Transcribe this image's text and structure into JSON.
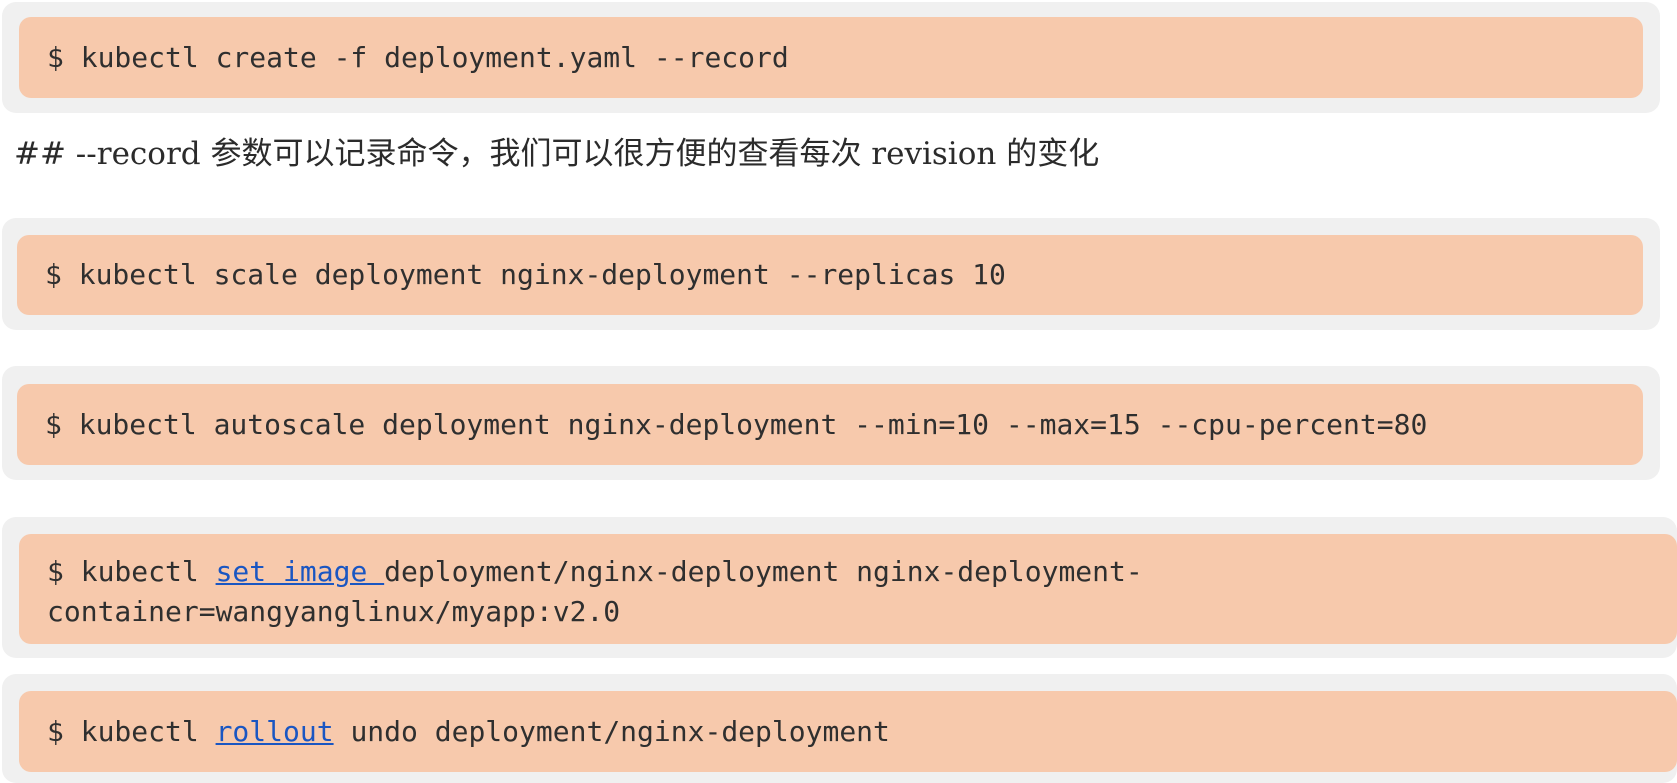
{
  "blocks": {
    "create": {
      "text": "$ kubectl create -f deployment.yaml --record"
    },
    "comment": "## --record 参数可以记录命令，我们可以很方便的查看每次 revision 的变化",
    "scale": {
      "text": "$ kubectl scale deployment nginx-deployment --replicas 10"
    },
    "autoscale": {
      "text": "$ kubectl autoscale deployment nginx-deployment --min=10 --max=15 --cpu-percent=80"
    },
    "set_image": {
      "prefix": "$ kubectl ",
      "link": "set image ",
      "suffix_line1": "deployment/nginx-deployment nginx-deployment-",
      "line2": "container=wangyanglinux/myapp:v2.0"
    },
    "undo": {
      "prefix": "$ kubectl ",
      "link": "rollout",
      "suffix": " undo deployment/nginx-deployment"
    }
  },
  "colors": {
    "block_background": "#f7c9ac",
    "frame_background": "#f0f0f0",
    "link": "#1a56c2",
    "text": "#2f2f2f"
  }
}
